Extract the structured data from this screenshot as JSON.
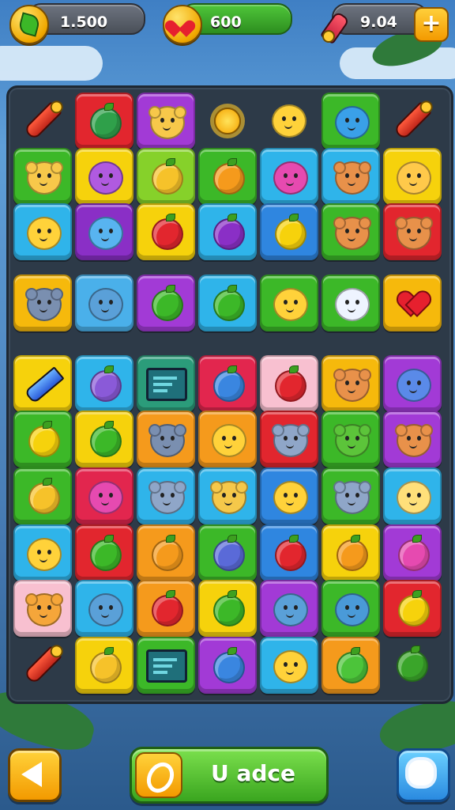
{
  "hud": {
    "coins": "1.500",
    "lives": "600",
    "boosters": "9.04",
    "plus_label": "+"
  },
  "footer": {
    "main_button_label": "U adce"
  },
  "board": {
    "rows": [
      [
        "carrot-red",
        "green-fruit",
        "cat-face",
        "sun",
        "chick-face",
        "blue-creature",
        "carrot-red"
      ],
      [
        "pig-face",
        "purple-face",
        "mango",
        "orange-fruit",
        "pink-face",
        "monkey-face",
        "orange-face"
      ],
      [
        "smile-face",
        "egg-face",
        "apple",
        "plum",
        "banana",
        "monkey-face",
        "monkey-face"
      ],
      [
        "hippo-face",
        "blob-face",
        "melon",
        "watermelon",
        "chick-face",
        "cloud-face",
        "heart"
      ],
      [
        "crayon",
        "mushroom",
        "screen",
        "egg-blue",
        "radish",
        "monkey-face",
        "octopus"
      ],
      [
        "star",
        "olive",
        "hippo-face",
        "smile-face",
        "elephant",
        "frog-face",
        "monkey-face"
      ],
      [
        "lemon",
        "pink-face",
        "elephant",
        "bear-face",
        "smile-face",
        "elephant",
        "cheeky-face"
      ],
      [
        "smile-face",
        "leaf",
        "orange-fruit",
        "cap",
        "cherry",
        "orange-fruit",
        "pink-fruit"
      ],
      [
        "tiger-face",
        "blob-face",
        "apple",
        "leaf",
        "blob-face",
        "fish-face",
        "lemon-yellow"
      ],
      [
        "carrot-red",
        "mango",
        "screen",
        "egg-blue",
        "chick-face",
        "lime",
        "cucumber"
      ]
    ],
    "tile_colors": [
      [
        "none",
        "#e2262e",
        "#a23ad6",
        "none",
        "none",
        "#3cb828",
        "none"
      ],
      [
        "#3cb828",
        "#f6d20c",
        "#86d12a",
        "#3cb828",
        "#2fb4ea",
        "#2fb4ea",
        "#f6d20c"
      ],
      [
        "#2fb4ea",
        "#8a2fc6",
        "#f6d20c",
        "#2fb4ea",
        "#2f86e0",
        "#3cb828",
        "#e2262e"
      ],
      [
        "#f6b90c",
        "#4ab0ea",
        "#a23ad6",
        "#2fb4ea",
        "#3cb828",
        "#3cb828",
        "#f6b90c"
      ],
      [
        "#f6d20c",
        "#2fb4ea",
        "#2b9c7a",
        "#e2264e",
        "#f8c0d0",
        "#f6b90c",
        "#a23ad6"
      ],
      [
        "#3cb828",
        "#f6d20c",
        "#f59a1c",
        "#f59a1c",
        "#e2262e",
        "#3cb828",
        "#a23ad6"
      ],
      [
        "#3cb828",
        "#e2264e",
        "#2fb4ea",
        "#2fb4ea",
        "#2f86e0",
        "#3cb828",
        "#2fb4ea"
      ],
      [
        "#2fb4ea",
        "#e2262e",
        "#f59a1c",
        "#3cb828",
        "#2f86e0",
        "#f6d20c",
        "#a23ad6"
      ],
      [
        "#f8c0d0",
        "#2fb4ea",
        "#f59a1c",
        "#f6d20c",
        "#a23ad6",
        "#3cb828",
        "#e2262e"
      ],
      [
        "none",
        "#f6d20c",
        "#3cb828",
        "#a23ad6",
        "#2fb4ea",
        "#f59a1c",
        "none"
      ]
    ]
  }
}
